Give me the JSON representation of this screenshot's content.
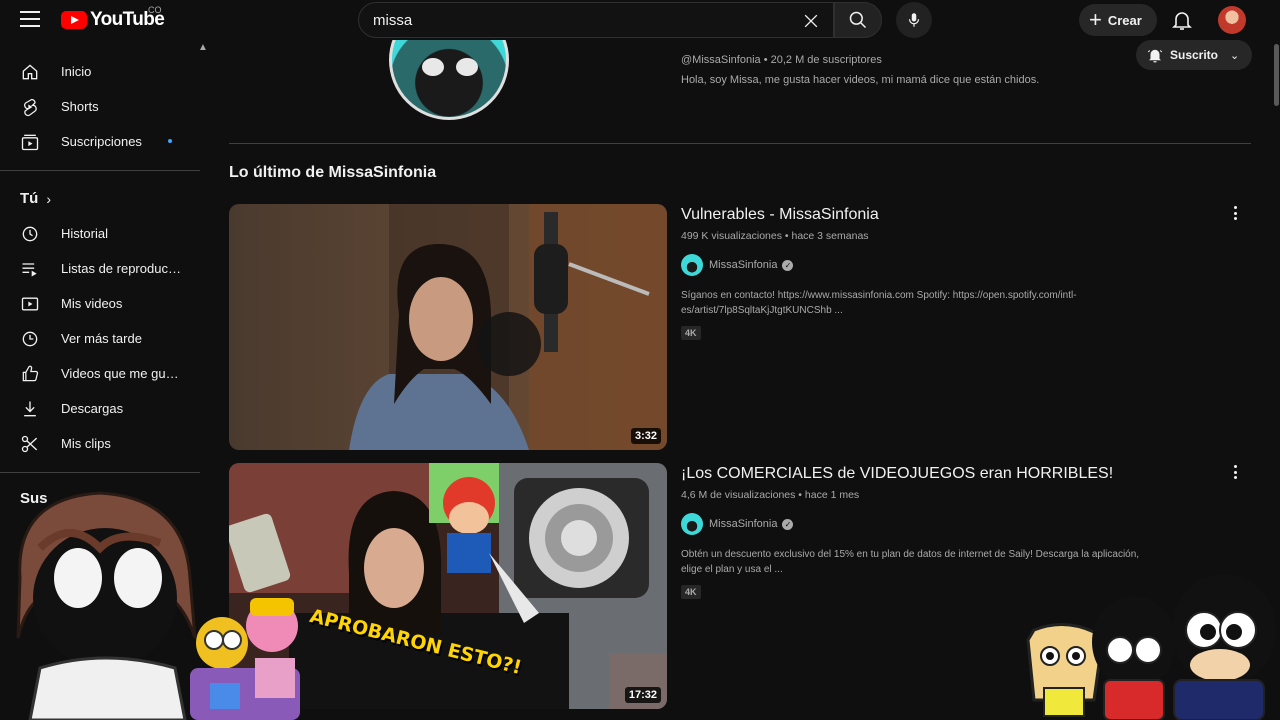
{
  "header": {
    "logo_text": "YouTube",
    "country_code": "CO",
    "search_value": "missa",
    "create_label": "Crear"
  },
  "sidebar": {
    "items": [
      {
        "label": "Inicio",
        "icon": "home-icon"
      },
      {
        "label": "Shorts",
        "icon": "shorts-icon"
      },
      {
        "label": "Suscripciones",
        "icon": "subscriptions-icon"
      }
    ],
    "you_heading": "Tú",
    "you_items": [
      {
        "label": "Historial",
        "icon": "history-icon"
      },
      {
        "label": "Listas de reproducc...",
        "icon": "playlists-icon"
      },
      {
        "label": "Mis videos",
        "icon": "my-videos-icon"
      },
      {
        "label": "Ver más tarde",
        "icon": "watch-later-icon"
      },
      {
        "label": "Videos que me gus...",
        "icon": "liked-icon"
      },
      {
        "label": "Descargas",
        "icon": "downloads-icon"
      },
      {
        "label": "Mis clips",
        "icon": "clips-icon"
      }
    ],
    "subs_heading": "Sus"
  },
  "channel": {
    "handle_and_subs": "@MissaSinfonia • 20,2 M de suscriptores",
    "description": "Hola, soy Missa, me gusta hacer videos, mi mamá dice que están chidos.",
    "subscribed_label": "Suscrito"
  },
  "shelf": {
    "title": "Lo último de MissaSinfonia"
  },
  "videos": [
    {
      "title": "Vulnerables - MissaSinfonia",
      "meta": "499 K visualizaciones • hace 3 semanas",
      "channel": "MissaSinfonia",
      "description": "Síganos en contacto! https://www.missasinfonia.com Spotify: https://open.spotify.com/intl-es/artist/7lp8SqltaKjJtgtKUNCShb ...",
      "badge": "4K",
      "duration": "3:32"
    },
    {
      "title": "¡Los COMERCIALES de VIDEOJUEGOS eran HORRIBLES!",
      "meta": "4,6 M de visualizaciones • hace 1 mes",
      "channel": "MissaSinfonia",
      "description": "Obtén un descuento exclusivo del 15% en tu plan de datos de internet de Saily! Descarga la aplicación, elige el plan y usa el ...",
      "badge": "4K",
      "duration": "17:32",
      "thumbnail_text": "APROBARON ESTO?!"
    }
  ],
  "colors": {
    "background": "#0f0f0f",
    "brand_red": "#ff0000",
    "accent_blue": "#3ea6ff"
  }
}
